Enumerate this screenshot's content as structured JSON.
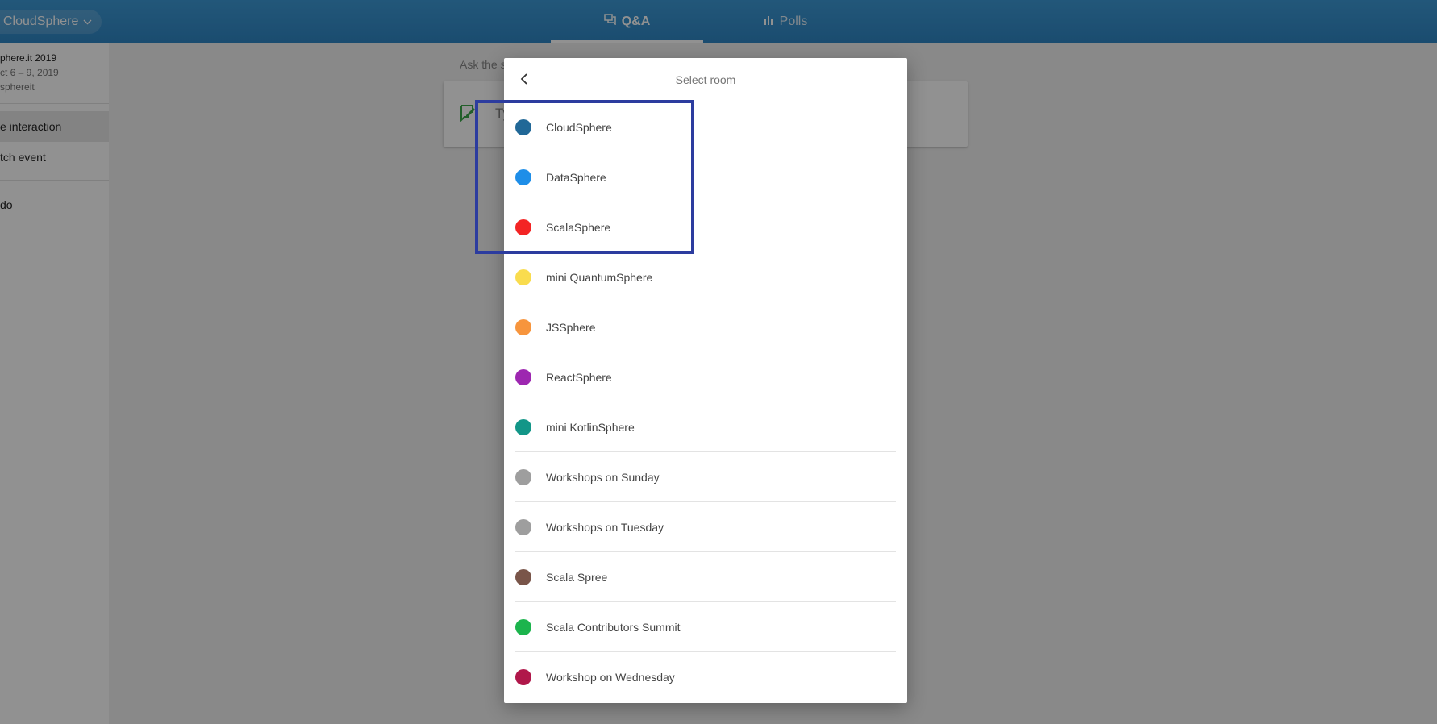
{
  "topbar": {
    "event_switcher_label": "CloudSphere",
    "tabs": [
      {
        "label": "Q&A",
        "icon": "chat-bubbles-icon",
        "active": true
      },
      {
        "label": "Polls",
        "icon": "bar-chart-icon",
        "active": false
      }
    ]
  },
  "sidebar": {
    "event_name": "phere.it 2019",
    "event_dates": "ct 6 – 9, 2019",
    "event_handle": "sphereit",
    "items": [
      {
        "label": "e interaction",
        "active": true
      },
      {
        "label": "tch event",
        "active": false
      },
      {
        "label": "do",
        "active": false
      }
    ]
  },
  "main": {
    "ask_label": "Ask the s",
    "input_placeholder": "Ty"
  },
  "modal": {
    "title": "Select room",
    "rooms": [
      {
        "name": "CloudSphere",
        "color": "#216897"
      },
      {
        "name": "DataSphere",
        "color": "#1e8ee8"
      },
      {
        "name": "ScalaSphere",
        "color": "#f32424"
      },
      {
        "name": "mini QuantumSphere",
        "color": "#f9dc4e"
      },
      {
        "name": "JSSphere",
        "color": "#f7953d"
      },
      {
        "name": "ReactSphere",
        "color": "#9d27b0"
      },
      {
        "name": "mini KotlinSphere",
        "color": "#139688"
      },
      {
        "name": "Workshops on Sunday",
        "color": "#9e9e9e"
      },
      {
        "name": "Workshops on Tuesday",
        "color": "#9e9e9e"
      },
      {
        "name": "Scala Spree",
        "color": "#795549"
      },
      {
        "name": "Scala Contributors Summit",
        "color": "#1cb44d"
      },
      {
        "name": "Workshop on Wednesday",
        "color": "#b0174a"
      }
    ]
  },
  "colors": {
    "topbar": "#3d9ad6",
    "highlight": "#2c3c9f",
    "edit_icon": "#3da84a"
  }
}
